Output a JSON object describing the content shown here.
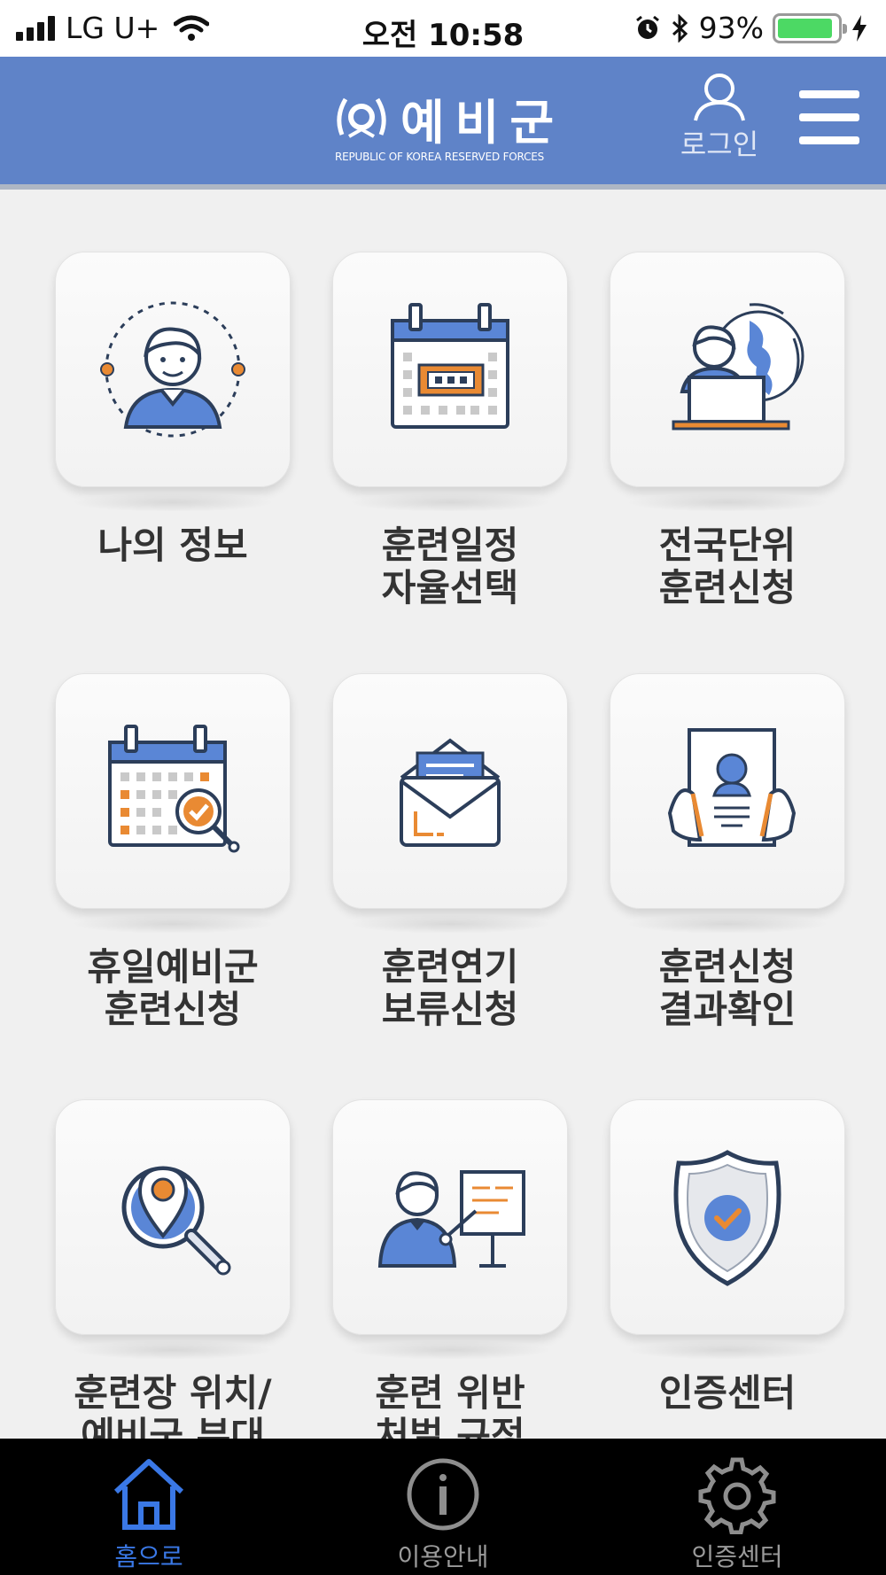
{
  "status_bar": {
    "carrier": "LG U+",
    "time": "오전 10:58",
    "battery_percent": "93%",
    "battery_level": 0.93
  },
  "header": {
    "logo_title": "예비군",
    "logo_subtitle": "REPUBLIC OF KOREA RESERVED FORCES",
    "login_label": "로그인",
    "colors": {
      "header_bg": "#5f83c8",
      "accent_orange": "#e98a33",
      "icon_blue": "#5a86d6"
    }
  },
  "menu": {
    "items": [
      {
        "label": "나의 정보",
        "icon": "user-profile-icon"
      },
      {
        "label": "훈련일정\n자율선택",
        "icon": "calendar-icon"
      },
      {
        "label": "전국단위\n훈련신청",
        "icon": "laptop-user-icon"
      },
      {
        "label": "휴일예비군\n훈련신청",
        "icon": "calendar-search-icon"
      },
      {
        "label": "훈련연기\n보류신청",
        "icon": "envelope-icon"
      },
      {
        "label": "훈련신청\n결과확인",
        "icon": "document-hands-icon"
      },
      {
        "label": "훈련장 위치/\n예비군 부대",
        "icon": "location-search-icon"
      },
      {
        "label": "훈련 위반\n처벌 규정",
        "icon": "presenter-icon"
      },
      {
        "label": "인증센터",
        "icon": "shield-check-icon"
      }
    ]
  },
  "bottom_nav": {
    "items": [
      {
        "label": "홈으로",
        "icon": "home-icon",
        "active": true
      },
      {
        "label": "이용안내",
        "icon": "info-icon",
        "active": false
      },
      {
        "label": "인증센터",
        "icon": "gear-icon",
        "active": false
      }
    ]
  }
}
